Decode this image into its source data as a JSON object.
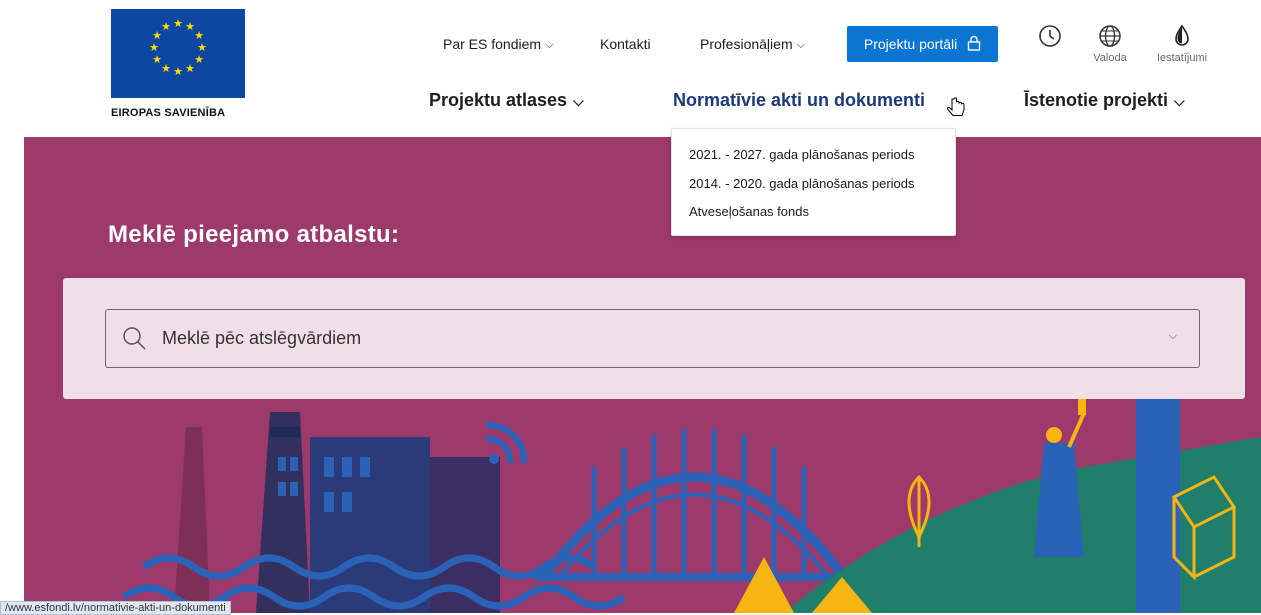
{
  "logo": {
    "caption": "EIROPAS SAVIENĪBA"
  },
  "top_nav": [
    {
      "label": "Par ES fondiem",
      "has_dropdown": true
    },
    {
      "label": "Kontakti",
      "has_dropdown": false
    },
    {
      "label": "Profesionāļiem",
      "has_dropdown": true
    }
  ],
  "portal_button": {
    "label": "Projektu portāli",
    "icon": "lock-icon"
  },
  "tools": {
    "history": {
      "icon": "clock-icon"
    },
    "language": {
      "icon": "globe-icon",
      "label": "Valoda"
    },
    "settings": {
      "icon": "drop-icon",
      "label": "Iestatījumi"
    }
  },
  "main_nav": [
    {
      "label": "Projektu atlases",
      "has_dropdown": true
    },
    {
      "label": "Normatīvie akti un dokumenti",
      "has_dropdown": true,
      "active": true
    },
    {
      "label": "Īstenotie projekti",
      "has_dropdown": true
    }
  ],
  "dropdown": {
    "items": [
      "2021. - 2027. gada plānošanas periods",
      "2014. - 2020. gada plānošanas periods",
      "Atveseļošanas fonds"
    ]
  },
  "hero": {
    "title": "Meklē pieejamo atbalstu:",
    "search_placeholder": "Meklē pēc atslēgvārdiem"
  },
  "status_bar": {
    "url": "/www.esfondi.lv/normativie-akti-un-dokumenti"
  },
  "colors": {
    "hero_bg": "#9b3a6b",
    "accent": "#0b76d1",
    "panel": "#f1dfe8",
    "eu_blue": "#0e47a1",
    "eu_star": "#ffdd00"
  }
}
